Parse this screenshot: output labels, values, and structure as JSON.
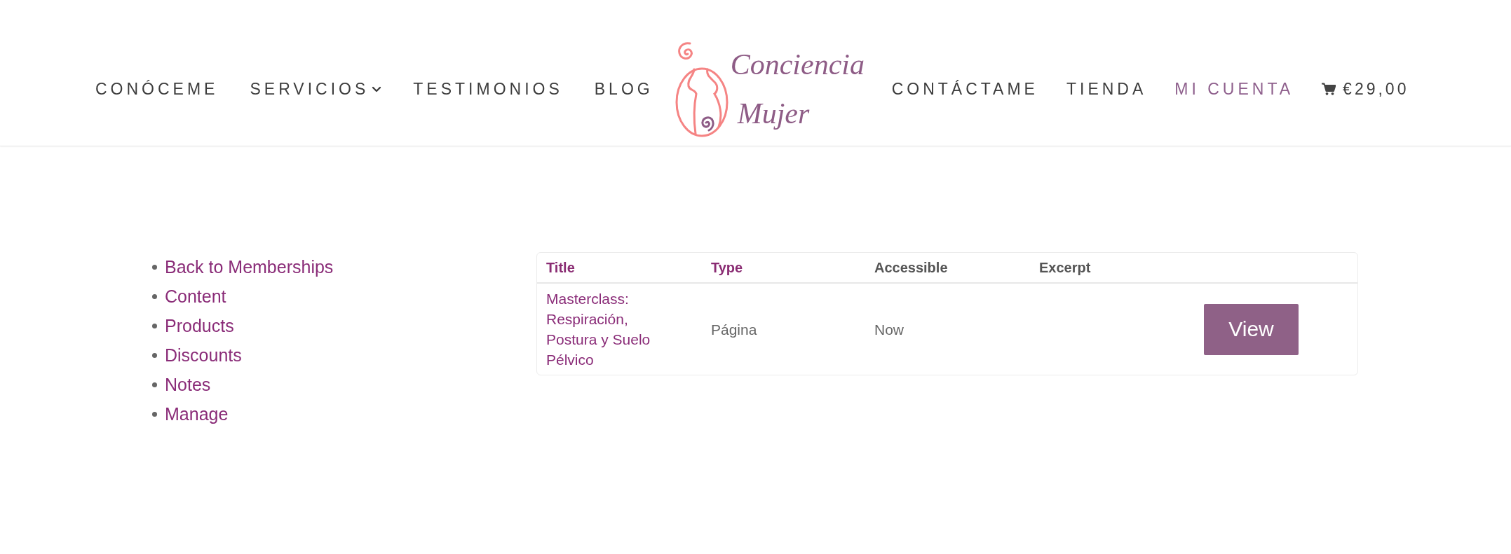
{
  "header": {
    "nav_left": [
      {
        "label": "CONÓCEME",
        "selected": false,
        "dropdown": false
      },
      {
        "label": "SERVICIOS",
        "selected": false,
        "dropdown": true
      },
      {
        "label": "TESTIMONIOS",
        "selected": false,
        "dropdown": false
      },
      {
        "label": "BLOG",
        "selected": false,
        "dropdown": false
      }
    ],
    "logo": {
      "text": "Conciencia Mujer"
    },
    "nav_right": [
      {
        "label": "CONTÁCTAME",
        "selected": false
      },
      {
        "label": "TIENDA",
        "selected": false
      },
      {
        "label": "MI CUENTA",
        "selected": true
      }
    ],
    "cart": {
      "total": "€29,00"
    }
  },
  "sidebar": {
    "items": [
      {
        "label": "Back to Memberships"
      },
      {
        "label": "Content"
      },
      {
        "label": "Products"
      },
      {
        "label": "Discounts"
      },
      {
        "label": "Notes"
      },
      {
        "label": "Manage"
      }
    ]
  },
  "table": {
    "columns": [
      {
        "label": "Title",
        "link": true
      },
      {
        "label": "Type",
        "link": true
      },
      {
        "label": "Accessible",
        "link": false
      },
      {
        "label": "Excerpt",
        "link": false
      }
    ],
    "rows": [
      {
        "title": "Masterclass: Respiración, Postura y Suelo Pélvico",
        "type": "Página",
        "accessible": "Now",
        "button": "View"
      }
    ]
  }
}
